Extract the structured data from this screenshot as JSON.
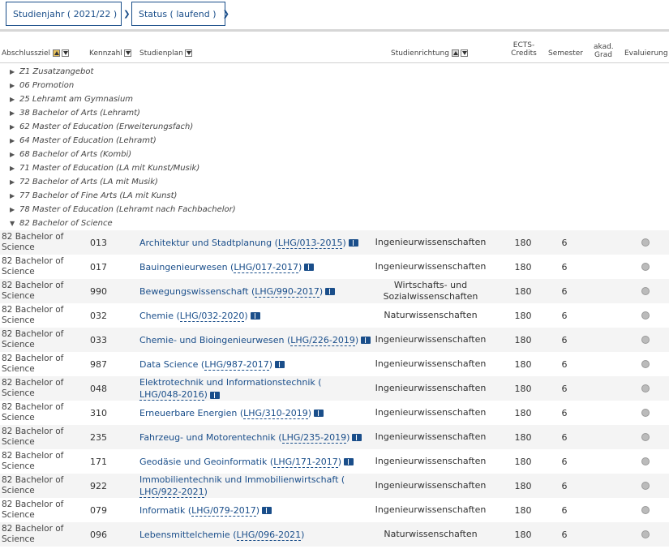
{
  "filters": [
    {
      "label": "Studienjahr ( 2021/22 )",
      "name": "studienjahr-filter"
    },
    {
      "label": "Status ( laufend )",
      "name": "status-filter"
    }
  ],
  "header": {
    "abschlussziel": "Abschlussziel",
    "kennzahl": "Kennzahl",
    "studienplan": "Studienplan",
    "studienrichtung": "Studienrichtung",
    "ects_1": "ECTS-",
    "ects_2": "Credits",
    "semester": "Semester",
    "grad_1": "akad.",
    "grad_2": "Grad",
    "evaluierung": "Evaluierung"
  },
  "groups": [
    {
      "label": "Z1 Zusatzangebot",
      "expanded": false
    },
    {
      "label": "06 Promotion",
      "expanded": false
    },
    {
      "label": "25 Lehramt am Gymnasium",
      "expanded": false
    },
    {
      "label": "38 Bachelor of Arts (Lehramt)",
      "expanded": false
    },
    {
      "label": "62 Master of Education (Erweiterungsfach)",
      "expanded": false
    },
    {
      "label": "64 Master of Education (Lehramt)",
      "expanded": false
    },
    {
      "label": "68 Bachelor of Arts (Kombi)",
      "expanded": false
    },
    {
      "label": "71 Master of Education (LA mit Kunst/Musik)",
      "expanded": false
    },
    {
      "label": "72 Bachelor of Arts (LA mit Musik)",
      "expanded": false
    },
    {
      "label": "77 Bachelor of Fine Arts (LA mit Kunst)",
      "expanded": false
    },
    {
      "label": "78 Master of Education (Lehramt nach Fachbachelor)",
      "expanded": false
    },
    {
      "label": "82 Bachelor of Science",
      "expanded": true
    }
  ],
  "rows": [
    {
      "ziel_1": "82 Bachelor of",
      "ziel_2": "Science",
      "kennzahl": "013",
      "plan_name": "Architektur und Stadtplanung",
      "plan_code": "LHG/013-2015",
      "plan_break": false,
      "richtung_1": "Ingenieurwissenschaften",
      "richtung_2": "",
      "ects": "180",
      "semester": "6",
      "book": true
    },
    {
      "ziel_1": "82 Bachelor of",
      "ziel_2": "Science",
      "kennzahl": "017",
      "plan_name": "Bauingenieurwesen",
      "plan_code": "LHG/017-2017",
      "plan_break": false,
      "richtung_1": "Ingenieurwissenschaften",
      "richtung_2": "",
      "ects": "180",
      "semester": "6",
      "book": true
    },
    {
      "ziel_1": "82 Bachelor of",
      "ziel_2": "Science",
      "kennzahl": "990",
      "plan_name": "Bewegungswissenschaft",
      "plan_code": "LHG/990-2017",
      "plan_break": false,
      "richtung_1": "Wirtschafts- und",
      "richtung_2": "Sozialwissenschaften",
      "ects": "180",
      "semester": "6",
      "book": true
    },
    {
      "ziel_1": "82 Bachelor of",
      "ziel_2": "Science",
      "kennzahl": "032",
      "plan_name": "Chemie",
      "plan_code": "LHG/032-2020",
      "plan_break": false,
      "richtung_1": "Naturwissenschaften",
      "richtung_2": "",
      "ects": "180",
      "semester": "6",
      "book": true
    },
    {
      "ziel_1": "82 Bachelor of",
      "ziel_2": "Science",
      "kennzahl": "033",
      "plan_name": "Chemie- und Bioingenieurwesen",
      "plan_code": "LHG/226-2019",
      "plan_break": false,
      "richtung_1": "Ingenieurwissenschaften",
      "richtung_2": "",
      "ects": "180",
      "semester": "6",
      "book": true
    },
    {
      "ziel_1": "82 Bachelor of",
      "ziel_2": "Science",
      "kennzahl": "987",
      "plan_name": "Data Science",
      "plan_code": "LHG/987-2017",
      "plan_break": false,
      "richtung_1": "Ingenieurwissenschaften",
      "richtung_2": "",
      "ects": "180",
      "semester": "6",
      "book": true
    },
    {
      "ziel_1": "82 Bachelor of",
      "ziel_2": "Science",
      "kennzahl": "048",
      "plan_name": "Elektrotechnik und Informationstechnik",
      "plan_code": "LHG/048-2016",
      "plan_break": true,
      "richtung_1": "Ingenieurwissenschaften",
      "richtung_2": "",
      "ects": "180",
      "semester": "6",
      "book": true
    },
    {
      "ziel_1": "82 Bachelor of",
      "ziel_2": "Science",
      "kennzahl": "310",
      "plan_name": "Erneuerbare Energien",
      "plan_code": "LHG/310-2019",
      "plan_break": false,
      "richtung_1": "Ingenieurwissenschaften",
      "richtung_2": "",
      "ects": "180",
      "semester": "6",
      "book": true
    },
    {
      "ziel_1": "82 Bachelor of",
      "ziel_2": "Science",
      "kennzahl": "235",
      "plan_name": "Fahrzeug- und Motorentechnik",
      "plan_code": "LHG/235-2019",
      "plan_break": false,
      "richtung_1": "Ingenieurwissenschaften",
      "richtung_2": "",
      "ects": "180",
      "semester": "6",
      "book": true
    },
    {
      "ziel_1": "82 Bachelor of",
      "ziel_2": "Science",
      "kennzahl": "171",
      "plan_name": "Geodäsie und Geoinformatik",
      "plan_code": "LHG/171-2017",
      "plan_break": false,
      "richtung_1": "Ingenieurwissenschaften",
      "richtung_2": "",
      "ects": "180",
      "semester": "6",
      "book": true
    },
    {
      "ziel_1": "82 Bachelor of",
      "ziel_2": "Science",
      "kennzahl": "922",
      "plan_name": "Immobilientechnik und Immobilienwirtschaft",
      "plan_code": "LHG/922-2021",
      "plan_break": true,
      "richtung_1": "Ingenieurwissenschaften",
      "richtung_2": "",
      "ects": "180",
      "semester": "6",
      "book": false
    },
    {
      "ziel_1": "82 Bachelor of",
      "ziel_2": "Science",
      "kennzahl": "079",
      "plan_name": "Informatik",
      "plan_code": "LHG/079-2017",
      "plan_break": false,
      "richtung_1": "Ingenieurwissenschaften",
      "richtung_2": "",
      "ects": "180",
      "semester": "6",
      "book": true
    },
    {
      "ziel_1": "82 Bachelor of",
      "ziel_2": "Science",
      "kennzahl": "096",
      "plan_name": "Lebensmittelchemie",
      "plan_code": "LHG/096-2021",
      "plan_break": false,
      "richtung_1": "Naturwissenschaften",
      "richtung_2": "",
      "ects": "180",
      "semester": "6",
      "book": false
    }
  ]
}
